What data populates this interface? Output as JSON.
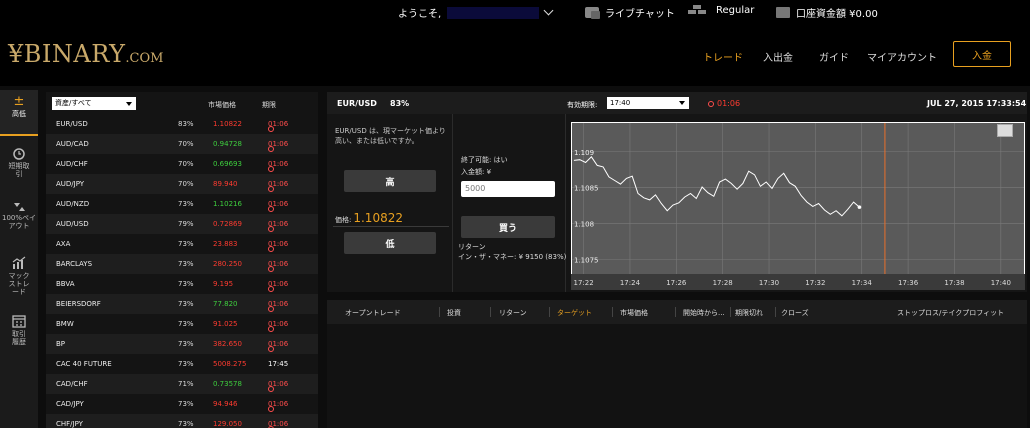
{
  "topbar": {
    "welcome": "ようこそ,",
    "live_chat": "ライブチャット",
    "account_type": "Regular",
    "balance_label": "口座資金額 ¥0.00"
  },
  "brand": {
    "logo": "BINARY",
    "logo_suffix": ".COM",
    "accent": "#e8a020"
  },
  "nav": {
    "items": [
      "トレード",
      "入出金",
      "ガイド",
      "マイアカウント"
    ],
    "active": "トレード",
    "deposit_button": "入金"
  },
  "sidebar": {
    "items": [
      {
        "label": "高低",
        "icon": "plus-minus-icon"
      },
      {
        "label": "短期取引",
        "icon": "clock-icon"
      },
      {
        "label": "100%ペイアウト",
        "icon": "arrows-icon"
      },
      {
        "label": "マックストレード",
        "icon": "trend-chart-icon"
      },
      {
        "label": "取引履歴",
        "icon": "calendar-icon"
      }
    ]
  },
  "assets": {
    "filter": "資産/すべて",
    "headers": {
      "price": "市場価格",
      "expiry": "期限"
    },
    "rows": [
      {
        "name": "EUR/USD",
        "pct": "83%",
        "price": "1.10822",
        "color": "red",
        "time": "01:06"
      },
      {
        "name": "AUD/CAD",
        "pct": "70%",
        "price": "0.94728",
        "color": "green",
        "time": "01:06"
      },
      {
        "name": "AUD/CHF",
        "pct": "70%",
        "price": "0.69693",
        "color": "green",
        "time": "01:06"
      },
      {
        "name": "AUD/JPY",
        "pct": "70%",
        "price": "89.940",
        "color": "red",
        "time": "01:06"
      },
      {
        "name": "AUD/NZD",
        "pct": "73%",
        "price": "1.10216",
        "color": "green",
        "time": "01:06"
      },
      {
        "name": "AUD/USD",
        "pct": "79%",
        "price": "0.72869",
        "color": "red",
        "time": "01:06"
      },
      {
        "name": "AXA",
        "pct": "73%",
        "price": "23.883",
        "color": "red",
        "time": "01:06"
      },
      {
        "name": "BARCLAYS",
        "pct": "73%",
        "price": "280.250",
        "color": "red",
        "time": "01:06"
      },
      {
        "name": "BBVA",
        "pct": "73%",
        "price": "9.195",
        "color": "red",
        "time": "01:06"
      },
      {
        "name": "BEIERSDORF",
        "pct": "73%",
        "price": "77.820",
        "color": "green",
        "time": "01:06"
      },
      {
        "name": "BMW",
        "pct": "73%",
        "price": "91.025",
        "color": "red",
        "time": "01:06"
      },
      {
        "name": "BP",
        "pct": "73%",
        "price": "382.650",
        "color": "red",
        "time": "01:06"
      },
      {
        "name": "CAC 40 FUTURE",
        "pct": "73%",
        "price": "5008.275",
        "color": "red",
        "time": "17:45"
      },
      {
        "name": "CAD/CHF",
        "pct": "71%",
        "price": "0.73578",
        "color": "green",
        "time": "01:06"
      },
      {
        "name": "CAD/JPY",
        "pct": "73%",
        "price": "94.946",
        "color": "red",
        "time": "01:06"
      },
      {
        "name": "CHF/JPY",
        "pct": "73%",
        "price": "129.050",
        "color": "red",
        "time": "01:06"
      }
    ]
  },
  "trade": {
    "asset": "EUR/USD",
    "payout": "83%",
    "expiry_label": "有効期限:",
    "expiry_value": "17:40",
    "countdown": "01:06",
    "datetime": "JUL 27, 2015 17:33:54",
    "description": "EUR/USD は、現マーケット価より高い、または低いですか。",
    "high_button": "高",
    "low_button": "低",
    "strike_label": "価格:",
    "strike_value": "1.10822",
    "tradable": "終了可能: はい",
    "amount_label": "入金額: ¥",
    "amount_value": "5000",
    "buy_button": "買う",
    "return_label": "リターン",
    "return_value": "イン・ザ・マネー: ¥ 9150 (83%)"
  },
  "chart_data": {
    "type": "line",
    "x_ticks": [
      "17:22",
      "17:24",
      "17:26",
      "17:28",
      "17:30",
      "17:32",
      "17:34",
      "17:36",
      "17:38",
      "17:40"
    ],
    "y_ticks": [
      "1.109",
      "1.1085",
      "1.108",
      "1.1075"
    ],
    "ylim": [
      1.1073,
      1.1094
    ],
    "xlim": [
      "17:21:30",
      "17:41:00"
    ],
    "expiry_marker": "17:35",
    "series": [
      {
        "values": [
          1.10888,
          1.10889,
          1.10885,
          1.10893,
          1.10881,
          1.10879,
          1.10865,
          1.1086,
          1.10855,
          1.10863,
          1.10866,
          1.10842,
          1.10836,
          1.10833,
          1.1084,
          1.10828,
          1.10818,
          1.10826,
          1.10829,
          1.10837,
          1.10842,
          1.10835,
          1.10851,
          1.10843,
          1.10838,
          1.10858,
          1.10862,
          1.10856,
          1.10848,
          1.10856,
          1.10873,
          1.10868,
          1.10852,
          1.10858,
          1.10849,
          1.10863,
          1.1087,
          1.10857,
          1.10852,
          1.10839,
          1.1083,
          1.10824,
          1.10828,
          1.10819,
          1.10813,
          1.10818,
          1.10811,
          1.1082,
          1.1083,
          1.10823
        ]
      }
    ]
  },
  "open_trades": {
    "headers": [
      "オープントレード",
      "投資",
      "リターン",
      "ターゲット",
      "市場価格",
      "開始時から...",
      "期限切れ",
      "クローズ",
      "ストップロス/テイクプロフィット"
    ]
  }
}
